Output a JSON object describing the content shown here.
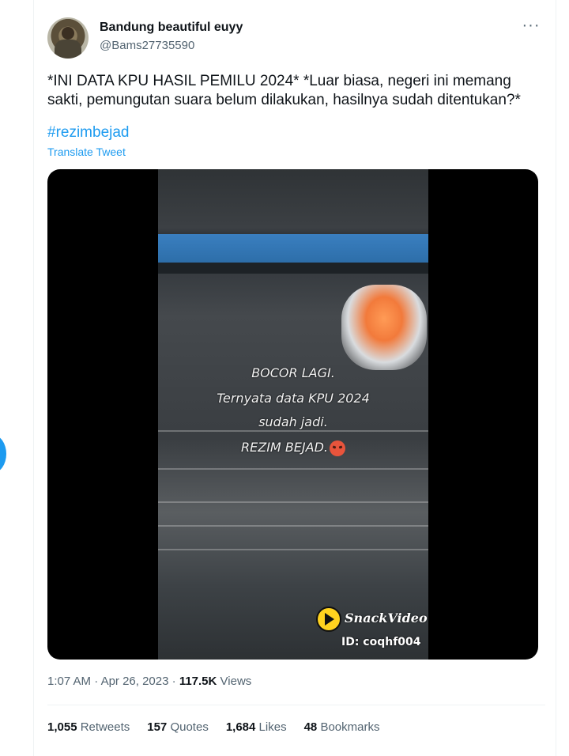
{
  "user": {
    "display_name": "Bandung beautiful euyy",
    "handle": "@Bams27735590",
    "more_label": "···"
  },
  "tweet": {
    "text": "*INI DATA KPU HASIL PEMILU 2024* *Luar biasa, negeri ini memang sakti, pemungutan suara belum dilakukan, hasilnya sudah ditentukan?*",
    "hashtag": "#rezimbejad",
    "translate_label": "Translate Tweet"
  },
  "media": {
    "overlay_lines": [
      "BOCOR LAGI.",
      "Ternyata data KPU 2024",
      "sudah jadi.",
      "REZIM BEJAD."
    ],
    "watermark_name": "SnackVideo",
    "watermark_id": "ID: coqhf004"
  },
  "meta": {
    "time": "1:07 AM",
    "separator": "·",
    "date": "Apr 26, 2023",
    "views_count": "117.5K",
    "views_label": "Views"
  },
  "stats": [
    {
      "count": "1,055",
      "label": "Retweets"
    },
    {
      "count": "157",
      "label": "Quotes"
    },
    {
      "count": "1,684",
      "label": "Likes"
    },
    {
      "count": "48",
      "label": "Bookmarks"
    }
  ],
  "colors": {
    "link": "#1d9bf0",
    "text": "#0f1419",
    "secondary": "#536471"
  }
}
